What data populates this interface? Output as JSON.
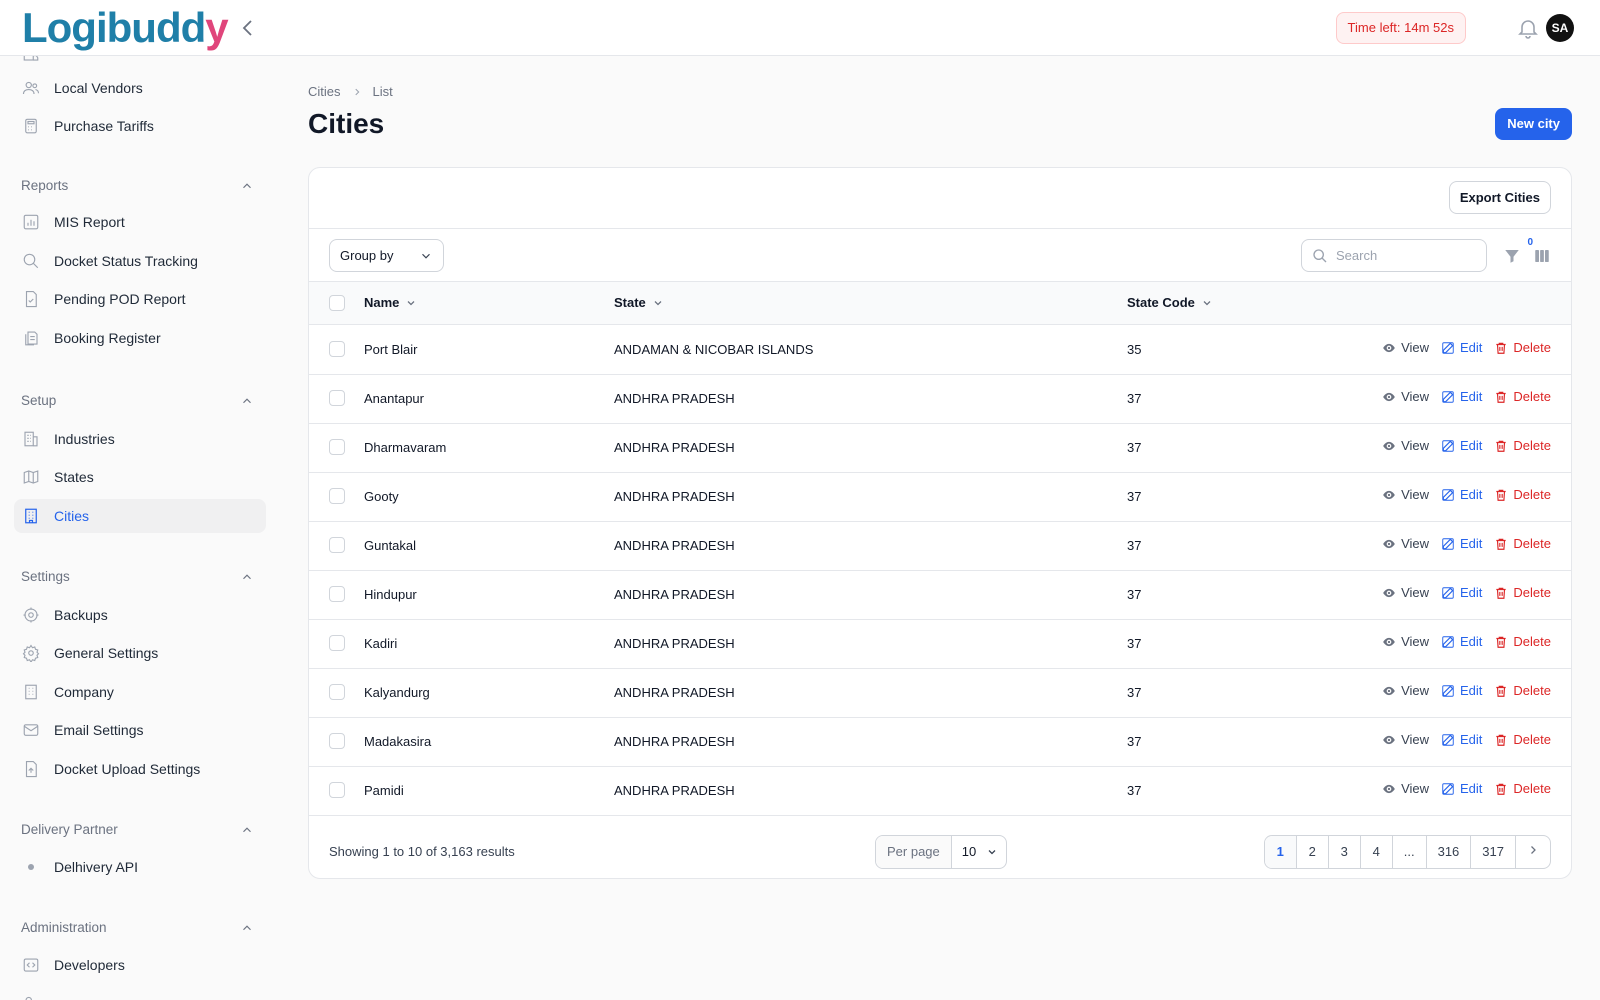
{
  "app": {
    "logo": "Logibuddy",
    "timer": "Time left: 14m 52s",
    "avatar": "SA"
  },
  "sidebar": {
    "top_items": [
      {
        "label": "Local Vendors",
        "icon": "users-icon"
      },
      {
        "label": "Purchase Tariffs",
        "icon": "calculator-icon"
      }
    ],
    "groups": [
      {
        "label": "Reports",
        "items": [
          {
            "label": "MIS Report",
            "icon": "chart-icon"
          },
          {
            "label": "Docket Status Tracking",
            "icon": "search-icon"
          },
          {
            "label": "Pending POD Report",
            "icon": "document-check-icon"
          },
          {
            "label": "Booking Register",
            "icon": "documents-icon"
          }
        ]
      },
      {
        "label": "Setup",
        "items": [
          {
            "label": "Industries",
            "icon": "building-icon"
          },
          {
            "label": "States",
            "icon": "map-icon"
          },
          {
            "label": "Cities",
            "icon": "office-building-icon",
            "active": true
          }
        ]
      },
      {
        "label": "Settings",
        "items": [
          {
            "label": "Backups",
            "icon": "cog-icon"
          },
          {
            "label": "General Settings",
            "icon": "gear-icon"
          },
          {
            "label": "Company",
            "icon": "building-icon"
          },
          {
            "label": "Email Settings",
            "icon": "envelope-icon"
          },
          {
            "label": "Docket Upload Settings",
            "icon": "document-upload-icon"
          }
        ]
      },
      {
        "label": "Delivery Partner",
        "items": [
          {
            "label": "Delhivery API",
            "icon": "bullet"
          }
        ]
      },
      {
        "label": "Administration",
        "items": [
          {
            "label": "Developers",
            "icon": "code-icon"
          }
        ]
      }
    ]
  },
  "breadcrumb": {
    "parent": "Cities",
    "current": "List"
  },
  "page": {
    "title": "Cities",
    "new_button": "New city"
  },
  "table": {
    "export_button": "Export Cities",
    "group_by": "Group by",
    "search_placeholder": "Search",
    "filter_count": "0",
    "columns": {
      "name": "Name",
      "state": "State",
      "state_code": "State Code"
    },
    "actions": {
      "view": "View",
      "edit": "Edit",
      "delete": "Delete"
    },
    "rows": [
      {
        "name": "Port Blair",
        "state": "ANDAMAN & NICOBAR ISLANDS",
        "code": "35"
      },
      {
        "name": "Anantapur",
        "state": "ANDHRA PRADESH",
        "code": "37"
      },
      {
        "name": "Dharmavaram",
        "state": "ANDHRA PRADESH",
        "code": "37"
      },
      {
        "name": "Gooty",
        "state": "ANDHRA PRADESH",
        "code": "37"
      },
      {
        "name": "Guntakal",
        "state": "ANDHRA PRADESH",
        "code": "37"
      },
      {
        "name": "Hindupur",
        "state": "ANDHRA PRADESH",
        "code": "37"
      },
      {
        "name": "Kadiri",
        "state": "ANDHRA PRADESH",
        "code": "37"
      },
      {
        "name": "Kalyandurg",
        "state": "ANDHRA PRADESH",
        "code": "37"
      },
      {
        "name": "Madakasira",
        "state": "ANDHRA PRADESH",
        "code": "37"
      },
      {
        "name": "Pamidi",
        "state": "ANDHRA PRADESH",
        "code": "37"
      }
    ],
    "showing": "Showing 1 to 10 of 3,163 results",
    "per_page_label": "Per page",
    "per_page_value": "10",
    "pages": [
      "1",
      "2",
      "3",
      "4",
      "...",
      "316",
      "317"
    ],
    "active_page": "1"
  },
  "colors": {
    "primary": "#2563eb",
    "danger": "#dc2626",
    "logo": "#1f7fa8"
  }
}
